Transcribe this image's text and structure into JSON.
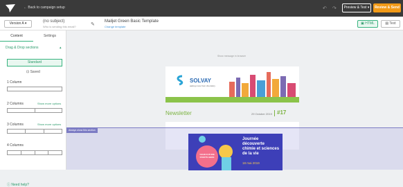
{
  "topbar": {
    "back_label": "Back to campaign setup",
    "preview_label": "Preview & Test ▾",
    "review_label": "Review & Send",
    "accent": "#f29a17"
  },
  "subbar": {
    "version": "Version A ▾",
    "subject": "(no subject)",
    "subject_hint": "Who is sending this email?",
    "template_name": "Mailjet Green Basic Template",
    "template_link": "Change template",
    "html_label": "HTML",
    "text_label": "Text"
  },
  "sidebar": {
    "tabs": [
      "Content",
      "Settings"
    ],
    "section": "Drag & Drop sections",
    "standard_label": "Standard",
    "saved_label": "Saved",
    "col1": "1 Column",
    "col2": "2 Columns",
    "col3": "3 Columns",
    "col4": "4 Columns",
    "more_options": "Show more options",
    "help": "Need help?",
    "accent": "#36b37e"
  },
  "canvas": {
    "browser_msg": "Show message in browser",
    "always_label": "Always show this section"
  },
  "email": {
    "brand": "SOLVAY",
    "brand_tag": "asking more from chemistry",
    "newsletter": "Newsletter",
    "date": "29 October 2019",
    "issue": "#17",
    "event_title_1": "Journée",
    "event_title_2": "découverte",
    "event_title_3": "chimie et sciences",
    "event_title_4": "de la vie",
    "event_date": "18 mai 2019",
    "event_tag": "YOUR FUTURE STARTS HERE"
  }
}
